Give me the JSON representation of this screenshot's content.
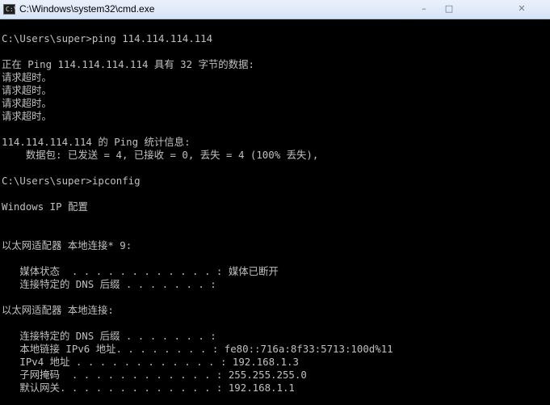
{
  "window": {
    "title": "C:\\Windows\\system32\\cmd.exe",
    "icon_label": "C:\\",
    "controls": {
      "minimize": "minimize-icon",
      "maximize": "maximize-icon",
      "close": "close-icon"
    }
  },
  "console": {
    "lines": [
      "C:\\Users\\super>ping 114.114.114.114",
      "正在 Ping 114.114.114.114 具有 32 字节的数据:",
      "请求超时。",
      "请求超时。",
      "请求超时。",
      "请求超时。",
      "114.114.114.114 的 Ping 统计信息:",
      "    数据包: 已发送 = 4, 已接收 = 0, 丢失 = 4 (100% 丢失),",
      "C:\\Users\\super>ipconfig",
      "Windows IP 配置",
      "以太网适配器 本地连接* 9:",
      "   媒体状态  . . . . . . . . . . . . : 媒体已断开",
      "   连接特定的 DNS 后缀 . . . . . . . :",
      "以太网适配器 本地连接:",
      "   连接特定的 DNS 后缀 . . . . . . . :",
      "   本地链接 IPv6 地址. . . . . . . . : fe80::716a:8f33:5713:100d%11",
      "   IPv4 地址 . . . . . . . . . . . . : 192.168.1.3",
      "   子网掩码  . . . . . . . . . . . . : 255.255.255.0",
      "   默认网关. . . . . . . . . . . . . : 192.168.1.1"
    ]
  },
  "colors": {
    "console_background": "#000000",
    "console_text": "#c0c0c0"
  }
}
